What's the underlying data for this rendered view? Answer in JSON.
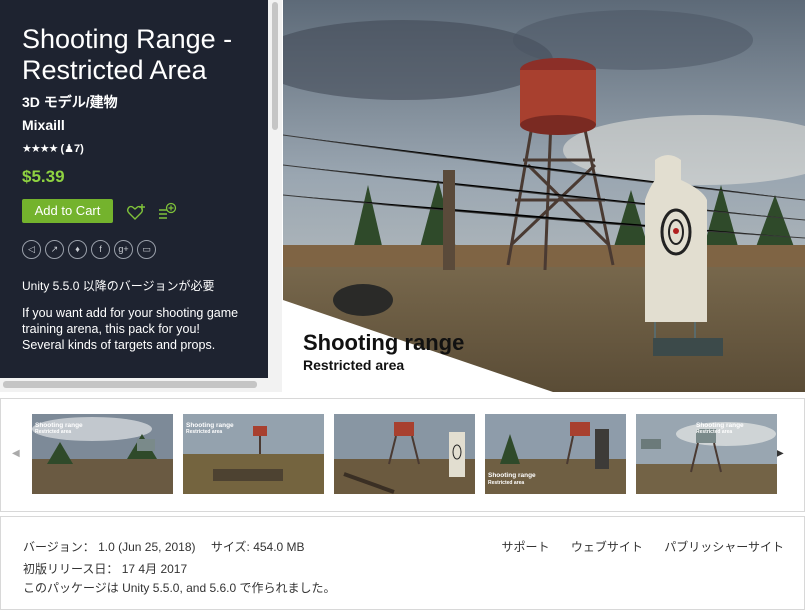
{
  "product": {
    "title": "Shooting Range - Restricted Area",
    "category": "3D モデル/建物",
    "publisher": "Mixaill",
    "stars": "★★★★",
    "rating_count": "(♟7)",
    "price": "$5.39",
    "add_to_cart_label": "Add to Cart",
    "requirement": "Unity 5.5.0 以降のバージョンが必要",
    "description": "If you want add for your shooting game training arena, this pack for you! Several kinds of targets and props."
  },
  "social_icons": [
    "share-icon",
    "link-icon",
    "twitter-icon",
    "facebook-icon",
    "google-plus-icon",
    "comment-icon"
  ],
  "hero": {
    "caption_line1": "Shooting range",
    "caption_line2": "Restricted area"
  },
  "thumbnails": [
    {
      "caption1": "Shooting range",
      "caption2": "Restricted area"
    },
    {
      "caption1": "Shooting range",
      "caption2": "Restricted area"
    },
    {
      "caption1": "",
      "caption2": ""
    },
    {
      "caption1": "Shooting range",
      "caption2": "Restricted area"
    },
    {
      "caption1": "Shooting range",
      "caption2": "Restricted area"
    }
  ],
  "details": {
    "version_label": "バージョン：",
    "version_value": "1.0 (Jun 25, 2018)",
    "size_label": "サイズ:",
    "size_value": "454.0 MB",
    "first_release_label": "初版リリース日：",
    "first_release_value": "17 4月 2017",
    "built_with": "このパッケージは Unity 5.5.0, and 5.6.0 で作られました。",
    "support_link": "サポート",
    "website_link": "ウェブサイト",
    "publisher_site_link": "パブリッシャーサイト"
  },
  "colors": {
    "panel_bg": "#1e2330",
    "price_green": "#8fd341",
    "button_green": "#74b32d"
  }
}
